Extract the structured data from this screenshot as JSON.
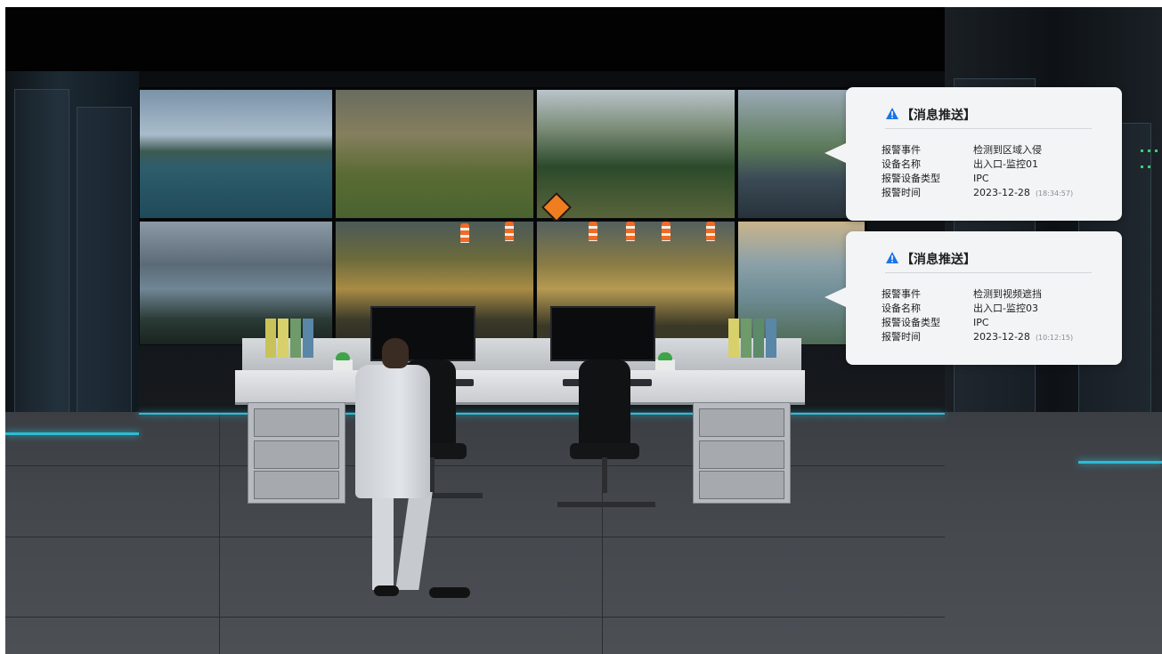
{
  "alerts": [
    {
      "title": "【消息推送】",
      "icon": "warning-triangle-icon",
      "icon_color": "#1b73e8",
      "fields": [
        {
          "label": "报警事件",
          "value": "检测到区域入侵"
        },
        {
          "label": "设备名称",
          "value": "出入口-监控01"
        },
        {
          "label": "报警设备类型",
          "value": "IPC"
        },
        {
          "label": "报警时间",
          "value": "2023-12-28",
          "time": "(18:34:57)"
        }
      ]
    },
    {
      "title": "【消息推送】",
      "icon": "warning-triangle-icon",
      "icon_color": "#1b73e8",
      "fields": [
        {
          "label": "报警事件",
          "value": "检测到视频遮挡"
        },
        {
          "label": "设备名称",
          "value": "出入口-监控03"
        },
        {
          "label": "报警设备类型",
          "value": "IPC"
        },
        {
          "label": "报警时间",
          "value": "2023-12-28",
          "time": "(10:12:15)"
        }
      ]
    }
  ],
  "colors": {
    "accent_glow": "#2bbcd6",
    "popup_bg": "#f3f4f6"
  }
}
